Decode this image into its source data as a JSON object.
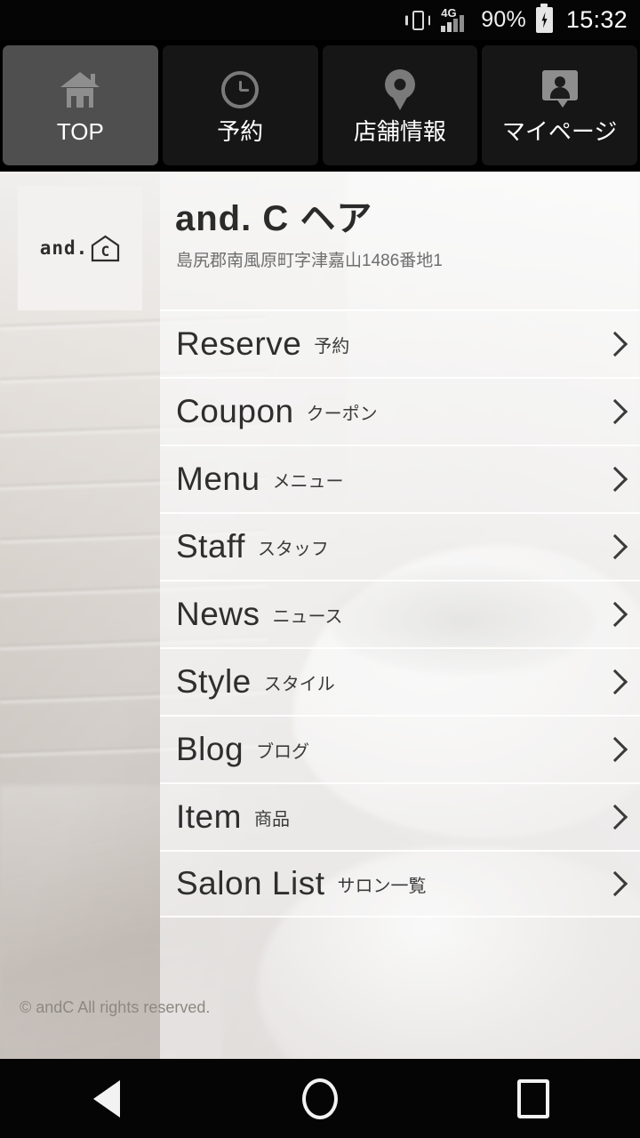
{
  "status_bar": {
    "vibrate_icon": "vibrate-icon",
    "network_label": "4G",
    "signal_icon": "signal-bars-icon",
    "battery_percent": "90%",
    "battery_icon": "battery-charging-icon",
    "time": "15:32"
  },
  "tabs": [
    {
      "label": "TOP",
      "icon": "home-icon",
      "active": true
    },
    {
      "label": "予約",
      "icon": "clock-icon",
      "active": false
    },
    {
      "label": "店舗情報",
      "icon": "map-pin-icon",
      "active": false
    },
    {
      "label": "マイページ",
      "icon": "user-badge-icon",
      "active": false
    }
  ],
  "header": {
    "logo_text": "and.",
    "logo_mark_letter": "C",
    "salon_name": "and. C ヘア",
    "address": "島尻郡南風原町字津嘉山1486番地1"
  },
  "menu": [
    {
      "en": "Reserve",
      "ja": "予約"
    },
    {
      "en": "Coupon",
      "ja": "クーポン"
    },
    {
      "en": "Menu",
      "ja": "メニュー"
    },
    {
      "en": "Staff",
      "ja": "スタッフ"
    },
    {
      "en": "News",
      "ja": "ニュース"
    },
    {
      "en": "Style",
      "ja": "スタイル"
    },
    {
      "en": "Blog",
      "ja": "ブログ"
    },
    {
      "en": "Item",
      "ja": "商品"
    },
    {
      "en": "Salon List",
      "ja": "サロン一覧"
    }
  ],
  "footer": {
    "copyright": "© andC All rights reserved."
  },
  "nav_bar": {
    "back": "back-icon",
    "home": "home-circle-icon",
    "recents": "recents-square-icon"
  },
  "colors": {
    "tab_active": "#4f4f4f",
    "tab_inactive": "#161616",
    "status_bar_bg": "#050505",
    "title_color": "#2b2b2b",
    "address_color": "#6e6e6e"
  }
}
